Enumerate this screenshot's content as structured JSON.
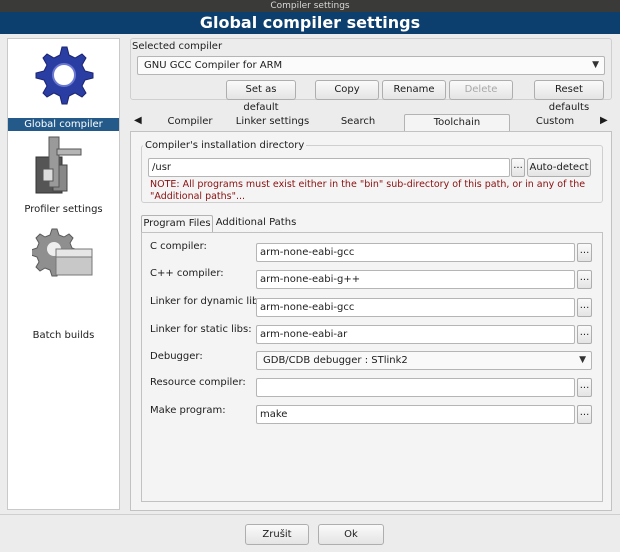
{
  "window": {
    "title": "Compiler settings",
    "header": "Global compiler settings"
  },
  "sidebar": {
    "items": [
      {
        "label": "Global compiler settings",
        "icon": "gear-icon",
        "selected": true
      },
      {
        "label": "Profiler settings",
        "icon": "caliper-icon",
        "selected": false
      },
      {
        "label": "Batch builds",
        "icon": "gear-box-icon",
        "selected": false
      }
    ]
  },
  "compiler": {
    "group_label": "Selected compiler",
    "selected": "GNU GCC Compiler for ARM",
    "buttons": {
      "set_default": "Set as default",
      "copy": "Copy",
      "rename": "Rename",
      "delete": "Delete",
      "reset": "Reset defaults"
    }
  },
  "tabs": [
    "Compiler settings",
    "Linker settings",
    "Search directories",
    "Toolchain executables",
    "Custom variables"
  ],
  "active_tab": "Toolchain executables",
  "install_dir": {
    "label": "Compiler's installation directory",
    "value": "/usr",
    "browse": "...",
    "autodetect": "Auto-detect",
    "note": "NOTE: All programs must exist either in the \"bin\" sub-directory of this path, or in any of the \"Additional paths\"..."
  },
  "subtabs": [
    "Program Files",
    "Additional Paths"
  ],
  "programs": {
    "c_compiler": {
      "label": "C compiler:",
      "value": "arm-none-eabi-gcc"
    },
    "cpp_compiler": {
      "label": "C++ compiler:",
      "value": "arm-none-eabi-g++"
    },
    "linker_dynamic": {
      "label": "Linker for dynamic libs:",
      "value": "arm-none-eabi-gcc"
    },
    "linker_static": {
      "label": "Linker for static libs:",
      "value": "arm-none-eabi-ar"
    },
    "debugger": {
      "label": "Debugger:",
      "value": "GDB/CDB debugger : STlink2"
    },
    "resource_compiler": {
      "label": "Resource compiler:",
      "value": ""
    },
    "make": {
      "label": "Make program:",
      "value": "make"
    },
    "browse": "..."
  },
  "footer": {
    "cancel": "Zrušit",
    "ok": "Ok"
  },
  "colors": {
    "header_bg": "#0c3f6e",
    "selected_bg": "#245a8a",
    "note_text": "#8a1010"
  }
}
